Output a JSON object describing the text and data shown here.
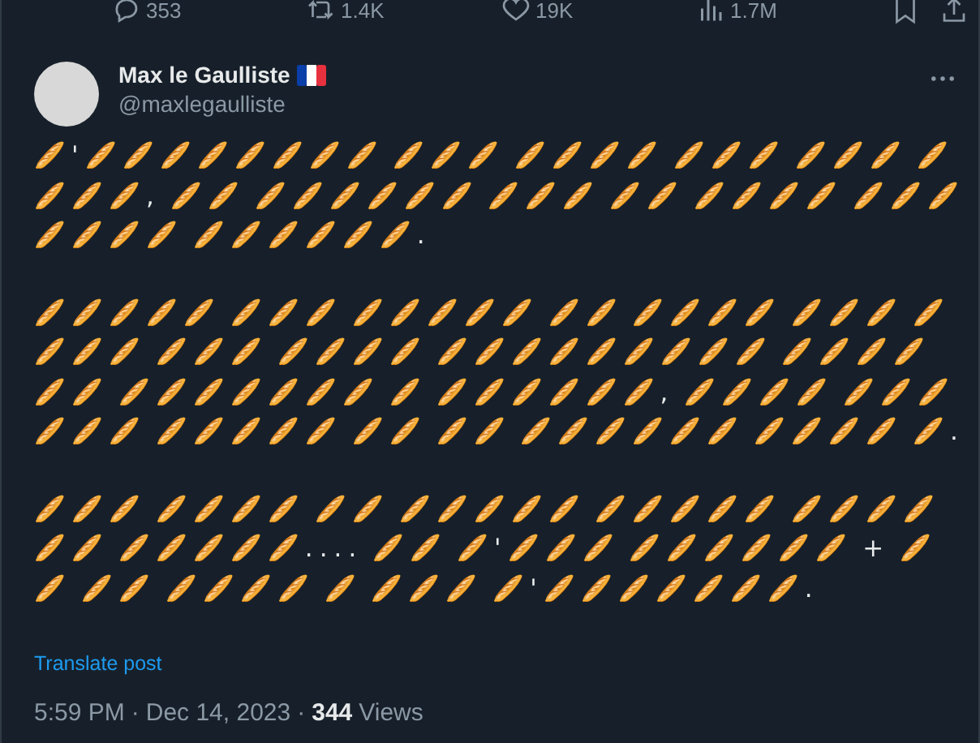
{
  "action_bar": {
    "replies": "353",
    "reposts": "1.4K",
    "likes": "19K",
    "views": "1.7M"
  },
  "post": {
    "author": {
      "name": "Max le Gaulliste",
      "handle": "@maxlegaulliste"
    },
    "paragraphs": [
      "🥖'🥖🥖🥖🥖🥖🥖🥖🥖 🥖🥖🥖 🥖🥖🥖🥖 🥖🥖🥖 🥖🥖🥖 🥖 🥖🥖🥖, 🥖🥖 🥖🥖🥖🥖🥖🥖 🥖🥖🥖 🥖🥖 🥖🥖🥖🥖 🥖🥖🥖 🥖🥖🥖🥖 🥖🥖🥖🥖🥖🥖.",
      "🥖🥖🥖🥖🥖 🥖🥖🥖 🥖🥖🥖🥖🥖 🥖🥖 🥖🥖🥖🥖 🥖🥖🥖 🥖 🥖🥖🥖 🥖🥖🥖 🥖🥖🥖🥖 🥖🥖🥖🥖🥖🥖🥖🥖🥖 🥖🥖🥖🥖 🥖🥖 🥖🥖🥖🥖🥖🥖🥖 🥖 🥖🥖🥖🥖🥖🥖, 🥖🥖🥖🥖 🥖🥖🥖 🥖🥖🥖 🥖🥖🥖🥖🥖 🥖🥖 🥖🥖 🥖🥖🥖🥖🥖🥖 🥖🥖🥖🥖 🥖.",
      "🥖🥖🥖 🥖🥖🥖🥖 🥖🥖 🥖🥖🥖🥖🥖 🥖🥖🥖🥖🥖 🥖🥖🥖🥖 🥖🥖 🥖🥖🥖🥖🥖.... 🥖🥖 🥖'🥖🥖🥖 🥖🥖🥖🥖🥖🥖 + 🥖🥖 🥖🥖 🥖🥖🥖🥖 🥖 🥖🥖🥖 🥖'🥖🥖🥖🥖🥖🥖🥖."
    ],
    "translate_link": "Translate post",
    "separator": "·",
    "time": "5:59 PM",
    "date": "Dec 14, 2023",
    "views_count": "344",
    "views_label": "Views"
  }
}
